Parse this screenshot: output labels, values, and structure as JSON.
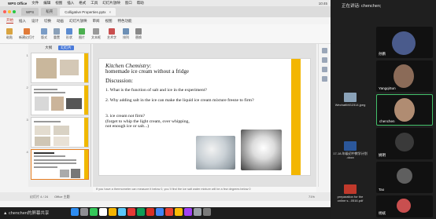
{
  "mac_menubar": {
    "app": "WPS Office",
    "menus": [
      "文件",
      "编辑",
      "视图",
      "插入",
      "格式",
      "工具",
      "幻灯片放映",
      "窗口",
      "帮助"
    ],
    "right": "10:45"
  },
  "doc_tabs": [
    {
      "label": "WPS",
      "active": false
    },
    {
      "label": "稻壳",
      "active": false
    },
    {
      "label": "Colligative Properties.pptx",
      "active": true
    }
  ],
  "ribbon_tabs": [
    "开始",
    "插入",
    "设计",
    "切换",
    "动画",
    "幻灯片放映",
    "审阅",
    "视图",
    "特色功能"
  ],
  "ribbon_active": "开始",
  "toolbar_items": [
    "粘贴",
    "新建幻灯片",
    "版式",
    "重置",
    "形状",
    "图片",
    "文本框",
    "艺术字",
    "排列",
    "替换"
  ],
  "sidebar": {
    "tabs": [
      "大纲",
      "幻灯片"
    ],
    "active": "幻灯片"
  },
  "thumbnails": [
    "1",
    "2",
    "3",
    "4"
  ],
  "slide": {
    "title": "Kitchen Chemistry",
    "title_suffix": ":",
    "subtitle": "homemade ice cream without a fridge",
    "discussion": "Discussion:",
    "q1": "1. What is the function of salt and ice in the experiment?",
    "q2": "2. Why adding salt in the ice can make the liquid ice cream mixture freeze to firm?",
    "q3": "3. ice cream not firm?",
    "q3_detail": "(forget to whip the light cream, over whipping, not enough ice or salt...)"
  },
  "notes": "If you have a thermometer can measure it below 0, you`ll find the ice salt water mixture will be a few degrees below 0",
  "status": {
    "slide": "幻灯片 4 / 24",
    "theme": "Office 主题",
    "zoom": "71%"
  },
  "sharer": "chenchen的屏幕共享",
  "speaking": "正在讲话: chenchen;",
  "participants": [
    {
      "name": "孙鹏"
    },
    {
      "name": "YangqiSun"
    },
    {
      "name": "chenchen"
    },
    {
      "name": "姚明"
    },
    {
      "name": "Tao"
    },
    {
      "name": "杨斌"
    }
  ],
  "desktop_files": [
    "WechatIMG2314.jpeg",
    "17-18-年级初中教学计划 .docx",
    "preparation for the online s...0516.pdf"
  ],
  "colors": {
    "accent": "#f3b600",
    "wps_red": "#c0392b",
    "selected_border": "#e67e22"
  }
}
